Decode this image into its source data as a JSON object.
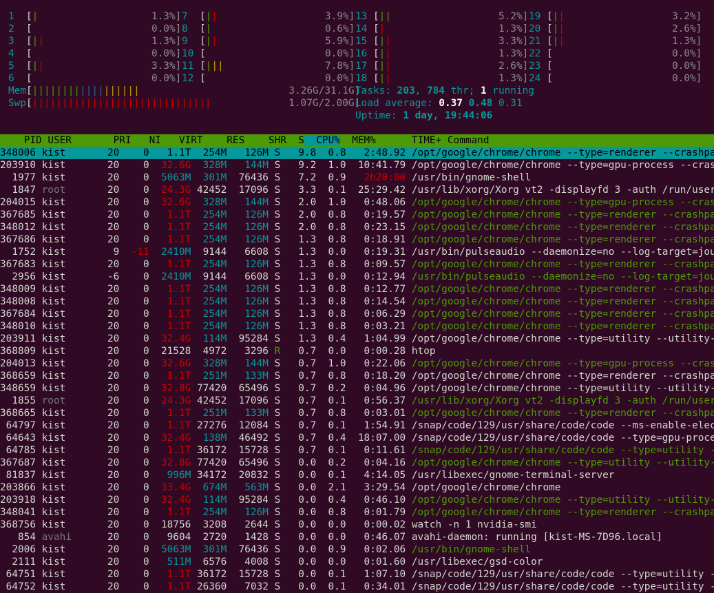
{
  "cpus": [
    {
      "id": "1",
      "bar": [
        [
          "|",
          "grn"
        ]
      ],
      "pct": "1.3%]"
    },
    {
      "id": "2",
      "bar": [],
      "pct": "0.0%]"
    },
    {
      "id": "3",
      "bar": [
        [
          "|",
          "grn"
        ],
        [
          "|",
          "red"
        ]
      ],
      "pct": "1.3%]"
    },
    {
      "id": "4",
      "bar": [],
      "pct": "0.0%]"
    },
    {
      "id": "5",
      "bar": [
        [
          "|",
          "grn"
        ],
        [
          "|",
          "red"
        ]
      ],
      "pct": "3.3%]"
    },
    {
      "id": "6",
      "bar": [],
      "pct": "0.0%]"
    },
    {
      "id": "7",
      "bar": [
        [
          "|",
          "grn"
        ],
        [
          "|",
          "red"
        ]
      ],
      "pct": "3.9%]"
    },
    {
      "id": "8",
      "bar": [
        [
          "|",
          "grn"
        ]
      ],
      "pct": "0.6%]"
    },
    {
      "id": "9",
      "bar": [
        [
          "|",
          "grn"
        ],
        [
          "|",
          "red"
        ]
      ],
      "pct": "5.9%]"
    },
    {
      "id": "10",
      "bar": [],
      "pct": "0.0%]"
    },
    {
      "id": "11",
      "bar": [
        [
          "|",
          "grn"
        ],
        [
          "||",
          "yel"
        ]
      ],
      "pct": "7.8%]"
    },
    {
      "id": "12",
      "bar": [],
      "pct": "0.0%]"
    },
    {
      "id": "13",
      "bar": [
        [
          "||",
          "grn"
        ]
      ],
      "pct": "5.2%]"
    },
    {
      "id": "14",
      "bar": [
        [
          "|",
          "red"
        ]
      ],
      "pct": "1.3%]"
    },
    {
      "id": "15",
      "bar": [
        [
          "|",
          "grn"
        ],
        [
          "|",
          "red"
        ]
      ],
      "pct": "3.3%]"
    },
    {
      "id": "16",
      "bar": [
        [
          "|",
          "grn"
        ],
        [
          "|",
          "red"
        ]
      ],
      "pct": "1.3%]"
    },
    {
      "id": "17",
      "bar": [
        [
          "|",
          "grn"
        ],
        [
          "|",
          "red"
        ]
      ],
      "pct": "2.6%]"
    },
    {
      "id": "18",
      "bar": [
        [
          "|",
          "grn"
        ],
        [
          "|",
          "red"
        ]
      ],
      "pct": "1.3%]"
    },
    {
      "id": "19",
      "bar": [
        [
          "|",
          "grn"
        ],
        [
          "|",
          "red"
        ]
      ],
      "pct": "3.2%]"
    },
    {
      "id": "20",
      "bar": [
        [
          "|",
          "grn"
        ],
        [
          "|",
          "red"
        ]
      ],
      "pct": "2.6%]"
    },
    {
      "id": "21",
      "bar": [
        [
          "|",
          "grn"
        ],
        [
          "|",
          "red"
        ]
      ],
      "pct": "1.3%]"
    },
    {
      "id": "22",
      "bar": [],
      "pct": "0.0%]"
    },
    {
      "id": "23",
      "bar": [],
      "pct": "0.0%]"
    },
    {
      "id": "24",
      "bar": [],
      "pct": "0.0%]"
    }
  ],
  "mem": {
    "label": "Mem",
    "bar": "||||||||||||||||||",
    "value": "3.26G/31.1G]"
  },
  "swp": {
    "label": "Swp",
    "bar": "||||||||||||||||||||||||||||||",
    "value": "1.07G/2.00G]"
  },
  "tasks": {
    "label": "Tasks: ",
    "count": "203",
    "sep": ", ",
    "thr": "784",
    "thr_label": " thr; ",
    "running": "1",
    "running_label": " running"
  },
  "load": {
    "label": "Load average: ",
    "l1": "0.37",
    "l5": "0.48",
    "l15": "0.31"
  },
  "uptime": {
    "label": "Uptime: ",
    "value": "1 day, 19:44:06"
  },
  "header": {
    "pid": "PID",
    "user": "USER",
    "pri": "PRI",
    "ni": "NI",
    "virt": "VIRT",
    "res": "RES",
    "shr": "SHR",
    "s": "S",
    "cpu": "CPU%",
    "mem": "MEM%",
    "time": "TIME+",
    "cmd": "Command"
  },
  "processes": [
    {
      "pid": "348006",
      "user": "kist",
      "pri": "20",
      "ni": "0",
      "virt": "1.1T",
      "res": "254M",
      "shr": "126M",
      "s": "S",
      "cpu": "9.8",
      "mem": "0.8",
      "time": "2:48.92",
      "cmd": "/opt/google/chrome/chrome --type=renderer --crashpa",
      "thread": false
    },
    {
      "pid": "203910",
      "user": "kist",
      "pri": "20",
      "ni": "0",
      "virt": "32.6G",
      "res": "328M",
      "shr": "144M",
      "s": "S",
      "cpu": "9.2",
      "mem": "1.0",
      "time": "10:41.79",
      "cmd": "/opt/google/chrome/chrome --type=gpu-process --cras",
      "thread": false
    },
    {
      "pid": "1977",
      "user": "kist",
      "pri": "20",
      "ni": "0",
      "virt": "5063M",
      "res": "301M",
      "shr": "76436",
      "s": "S",
      "cpu": "7.2",
      "mem": "0.9",
      "time": "2h20:00",
      "cmd": "/usr/bin/gnome-shell",
      "thread": false
    },
    {
      "pid": "1847",
      "user": "root",
      "pri": "20",
      "ni": "0",
      "virt": "24.3G",
      "res": "42452",
      "shr": "17096",
      "s": "S",
      "cpu": "3.3",
      "mem": "0.1",
      "time": "25:29.42",
      "cmd": "/usr/lib/xorg/Xorg vt2 -displayfd 3 -auth /run/user",
      "thread": false
    },
    {
      "pid": "204015",
      "user": "kist",
      "pri": "20",
      "ni": "0",
      "virt": "32.6G",
      "res": "328M",
      "shr": "144M",
      "s": "S",
      "cpu": "2.0",
      "mem": "1.0",
      "time": "0:48.06",
      "cmd": "/opt/google/chrome/chrome --type=gpu-process --cras",
      "thread": true
    },
    {
      "pid": "367685",
      "user": "kist",
      "pri": "20",
      "ni": "0",
      "virt": "1.1T",
      "res": "254M",
      "shr": "126M",
      "s": "S",
      "cpu": "2.0",
      "mem": "0.8",
      "time": "0:19.57",
      "cmd": "/opt/google/chrome/chrome --type=renderer --crashpa",
      "thread": true
    },
    {
      "pid": "348012",
      "user": "kist",
      "pri": "20",
      "ni": "0",
      "virt": "1.1T",
      "res": "254M",
      "shr": "126M",
      "s": "S",
      "cpu": "2.0",
      "mem": "0.8",
      "time": "0:23.15",
      "cmd": "/opt/google/chrome/chrome --type=renderer --crashpa",
      "thread": true
    },
    {
      "pid": "367686",
      "user": "kist",
      "pri": "20",
      "ni": "0",
      "virt": "1.1T",
      "res": "254M",
      "shr": "126M",
      "s": "S",
      "cpu": "1.3",
      "mem": "0.8",
      "time": "0:18.91",
      "cmd": "/opt/google/chrome/chrome --type=renderer --crashpa",
      "thread": true
    },
    {
      "pid": "1752",
      "user": "kist",
      "pri": "9",
      "ni": "-11",
      "virt": "2410M",
      "res": "9144",
      "shr": "6608",
      "s": "S",
      "cpu": "1.3",
      "mem": "0.0",
      "time": "0:19.31",
      "cmd": "/usr/bin/pulseaudio --daemonize=no --log-target=jou",
      "thread": false
    },
    {
      "pid": "367683",
      "user": "kist",
      "pri": "20",
      "ni": "0",
      "virt": "1.1T",
      "res": "254M",
      "shr": "126M",
      "s": "S",
      "cpu": "1.3",
      "mem": "0.8",
      "time": "0:09.57",
      "cmd": "/opt/google/chrome/chrome --type=renderer --crashpa",
      "thread": true
    },
    {
      "pid": "2956",
      "user": "kist",
      "pri": "-6",
      "ni": "0",
      "virt": "2410M",
      "res": "9144",
      "shr": "6608",
      "s": "S",
      "cpu": "1.3",
      "mem": "0.0",
      "time": "0:12.94",
      "cmd": "/usr/bin/pulseaudio --daemonize=no --log-target=jou",
      "thread": true
    },
    {
      "pid": "348009",
      "user": "kist",
      "pri": "20",
      "ni": "0",
      "virt": "1.1T",
      "res": "254M",
      "shr": "126M",
      "s": "S",
      "cpu": "1.3",
      "mem": "0.8",
      "time": "0:12.77",
      "cmd": "/opt/google/chrome/chrome --type=renderer --crashpa",
      "thread": true
    },
    {
      "pid": "348008",
      "user": "kist",
      "pri": "20",
      "ni": "0",
      "virt": "1.1T",
      "res": "254M",
      "shr": "126M",
      "s": "S",
      "cpu": "1.3",
      "mem": "0.8",
      "time": "0:14.54",
      "cmd": "/opt/google/chrome/chrome --type=renderer --crashpa",
      "thread": true
    },
    {
      "pid": "367684",
      "user": "kist",
      "pri": "20",
      "ni": "0",
      "virt": "1.1T",
      "res": "254M",
      "shr": "126M",
      "s": "S",
      "cpu": "1.3",
      "mem": "0.8",
      "time": "0:06.29",
      "cmd": "/opt/google/chrome/chrome --type=renderer --crashpa",
      "thread": true
    },
    {
      "pid": "348010",
      "user": "kist",
      "pri": "20",
      "ni": "0",
      "virt": "1.1T",
      "res": "254M",
      "shr": "126M",
      "s": "S",
      "cpu": "1.3",
      "mem": "0.8",
      "time": "0:03.21",
      "cmd": "/opt/google/chrome/chrome --type=renderer --crashpa",
      "thread": true
    },
    {
      "pid": "203911",
      "user": "kist",
      "pri": "20",
      "ni": "0",
      "virt": "32.4G",
      "res": "114M",
      "shr": "95284",
      "s": "S",
      "cpu": "1.3",
      "mem": "0.4",
      "time": "1:04.99",
      "cmd": "/opt/google/chrome/chrome --type=utility --utility-",
      "thread": false
    },
    {
      "pid": "368809",
      "user": "kist",
      "pri": "20",
      "ni": "0",
      "virt": "21528",
      "res": "4972",
      "shr": "3296",
      "s": "R",
      "cpu": "0.7",
      "mem": "0.0",
      "time": "0:00.28",
      "cmd": "htop",
      "thread": false
    },
    {
      "pid": "204013",
      "user": "kist",
      "pri": "20",
      "ni": "0",
      "virt": "32.6G",
      "res": "328M",
      "shr": "144M",
      "s": "S",
      "cpu": "0.7",
      "mem": "1.0",
      "time": "0:22.06",
      "cmd": "/opt/google/chrome/chrome --type=gpu-process --cras",
      "thread": true
    },
    {
      "pid": "368659",
      "user": "kist",
      "pri": "20",
      "ni": "0",
      "virt": "1.1T",
      "res": "251M",
      "shr": "133M",
      "s": "S",
      "cpu": "0.7",
      "mem": "0.8",
      "time": "0:18.20",
      "cmd": "/opt/google/chrome/chrome --type=renderer --crashpa",
      "thread": false
    },
    {
      "pid": "348659",
      "user": "kist",
      "pri": "20",
      "ni": "0",
      "virt": "32.8G",
      "res": "77420",
      "shr": "65496",
      "s": "S",
      "cpu": "0.7",
      "mem": "0.2",
      "time": "0:04.96",
      "cmd": "/opt/google/chrome/chrome --type=utility --utility-",
      "thread": false
    },
    {
      "pid": "1855",
      "user": "root",
      "pri": "20",
      "ni": "0",
      "virt": "24.3G",
      "res": "42452",
      "shr": "17096",
      "s": "S",
      "cpu": "0.7",
      "mem": "0.1",
      "time": "0:56.37",
      "cmd": "/usr/lib/xorg/Xorg vt2 -displayfd 3 -auth /run/user",
      "thread": true
    },
    {
      "pid": "368665",
      "user": "kist",
      "pri": "20",
      "ni": "0",
      "virt": "1.1T",
      "res": "251M",
      "shr": "133M",
      "s": "S",
      "cpu": "0.7",
      "mem": "0.8",
      "time": "0:03.01",
      "cmd": "/opt/google/chrome/chrome --type=renderer --crashpa",
      "thread": true
    },
    {
      "pid": "64797",
      "user": "kist",
      "pri": "20",
      "ni": "0",
      "virt": "1.1T",
      "res": "27276",
      "shr": "12084",
      "s": "S",
      "cpu": "0.7",
      "mem": "0.1",
      "time": "1:54.91",
      "cmd": "/snap/code/129/usr/share/code/code --ms-enable-elec",
      "thread": false
    },
    {
      "pid": "64643",
      "user": "kist",
      "pri": "20",
      "ni": "0",
      "virt": "32.4G",
      "res": "138M",
      "shr": "46492",
      "s": "S",
      "cpu": "0.7",
      "mem": "0.4",
      "time": "18:07.00",
      "cmd": "/snap/code/129/usr/share/code/code --type=gpu-proce",
      "thread": false
    },
    {
      "pid": "64785",
      "user": "kist",
      "pri": "20",
      "ni": "0",
      "virt": "1.1T",
      "res": "36172",
      "shr": "15728",
      "s": "S",
      "cpu": "0.7",
      "mem": "0.1",
      "time": "0:11.61",
      "cmd": "/snap/code/129/usr/share/code/code --type=utility -",
      "thread": true
    },
    {
      "pid": "367687",
      "user": "kist",
      "pri": "20",
      "ni": "0",
      "virt": "32.8G",
      "res": "77420",
      "shr": "65496",
      "s": "S",
      "cpu": "0.0",
      "mem": "0.2",
      "time": "0:04.16",
      "cmd": "/opt/google/chrome/chrome --type=utility --utility-",
      "thread": true
    },
    {
      "pid": "81837",
      "user": "kist",
      "pri": "20",
      "ni": "0",
      "virt": "996M",
      "res": "34172",
      "shr": "20832",
      "s": "S",
      "cpu": "0.0",
      "mem": "0.1",
      "time": "4:14.05",
      "cmd": "/usr/libexec/gnome-terminal-server",
      "thread": false
    },
    {
      "pid": "203866",
      "user": "kist",
      "pri": "20",
      "ni": "0",
      "virt": "33.4G",
      "res": "674M",
      "shr": "563M",
      "s": "S",
      "cpu": "0.0",
      "mem": "2.1",
      "time": "3:29.54",
      "cmd": "/opt/google/chrome/chrome",
      "thread": false
    },
    {
      "pid": "203918",
      "user": "kist",
      "pri": "20",
      "ni": "0",
      "virt": "32.4G",
      "res": "114M",
      "shr": "95284",
      "s": "S",
      "cpu": "0.0",
      "mem": "0.4",
      "time": "0:46.10",
      "cmd": "/opt/google/chrome/chrome --type=utility --utility-",
      "thread": true
    },
    {
      "pid": "348041",
      "user": "kist",
      "pri": "20",
      "ni": "0",
      "virt": "1.1T",
      "res": "254M",
      "shr": "126M",
      "s": "S",
      "cpu": "0.0",
      "mem": "0.8",
      "time": "0:01.79",
      "cmd": "/opt/google/chrome/chrome --type=renderer --crashpa",
      "thread": true
    },
    {
      "pid": "368756",
      "user": "kist",
      "pri": "20",
      "ni": "0",
      "virt": "18756",
      "res": "3208",
      "shr": "2644",
      "s": "S",
      "cpu": "0.0",
      "mem": "0.0",
      "time": "0:00.02",
      "cmd": "watch -n 1 nvidia-smi",
      "thread": false
    },
    {
      "pid": "854",
      "user": "avahi",
      "pri": "20",
      "ni": "0",
      "virt": "9604",
      "res": "2720",
      "shr": "1428",
      "s": "S",
      "cpu": "0.0",
      "mem": "0.0",
      "time": "0:46.07",
      "cmd": "avahi-daemon: running [kist-MS-7D96.local]",
      "thread": false
    },
    {
      "pid": "2006",
      "user": "kist",
      "pri": "20",
      "ni": "0",
      "virt": "5063M",
      "res": "301M",
      "shr": "76436",
      "s": "S",
      "cpu": "0.0",
      "mem": "0.9",
      "time": "0:02.06",
      "cmd": "/usr/bin/gnome-shell",
      "thread": true
    },
    {
      "pid": "2111",
      "user": "kist",
      "pri": "20",
      "ni": "0",
      "virt": "511M",
      "res": "6576",
      "shr": "4008",
      "s": "S",
      "cpu": "0.0",
      "mem": "0.0",
      "time": "0:01.60",
      "cmd": "/usr/libexec/gsd-color",
      "thread": false
    },
    {
      "pid": "64751",
      "user": "kist",
      "pri": "20",
      "ni": "0",
      "virt": "1.1T",
      "res": "36172",
      "shr": "15728",
      "s": "S",
      "cpu": "0.0",
      "mem": "0.1",
      "time": "1:07.10",
      "cmd": "/snap/code/129/usr/share/code/code --type=utility -",
      "thread": false
    },
    {
      "pid": "64752",
      "user": "kist",
      "pri": "20",
      "ni": "0",
      "virt": "1.1T",
      "res": "26360",
      "shr": "7032",
      "s": "S",
      "cpu": "0.0",
      "mem": "0.1",
      "time": "0:34.01",
      "cmd": "/snap/code/129/usr/share/code/code --type=utility -",
      "thread": false
    }
  ]
}
